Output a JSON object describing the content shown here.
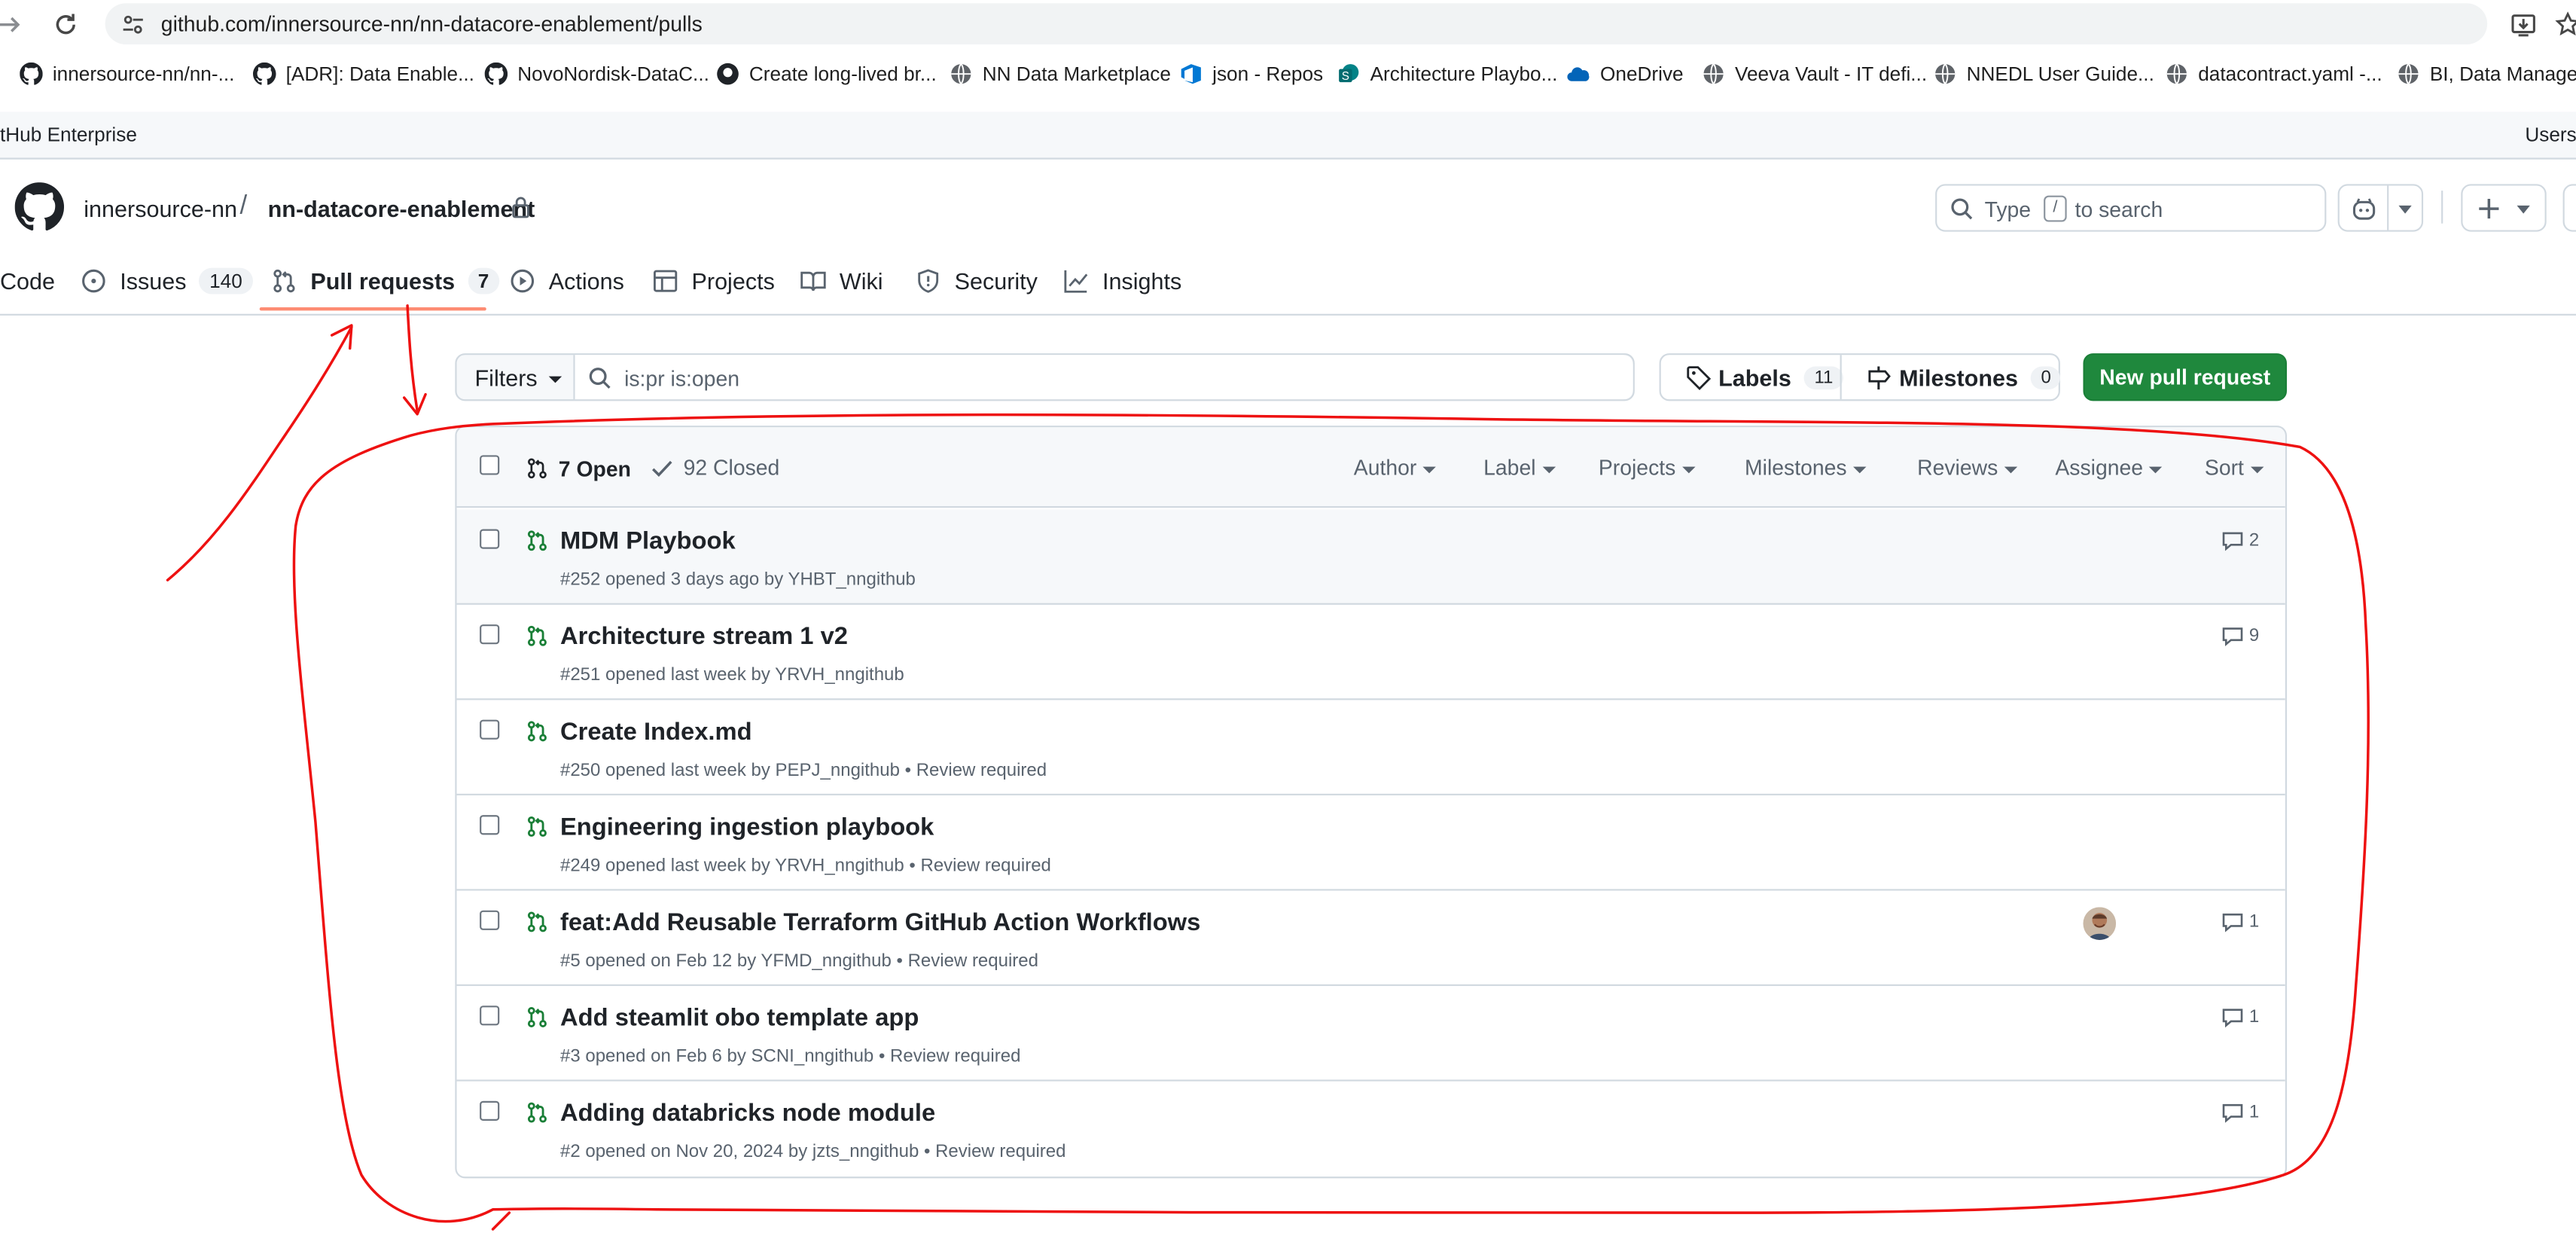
{
  "browser": {
    "url": "github.com/innersource-nn/nn-datacore-enablement/pulls",
    "bookmarks": [
      {
        "label": "innersource-nn/nn-...",
        "icon": "github-icon"
      },
      {
        "label": "[ADR]: Data Enable...",
        "icon": "github-icon"
      },
      {
        "label": "NovoNordisk-DataC...",
        "icon": "github-icon"
      },
      {
        "label": "Create long-lived br...",
        "icon": "github-icon"
      },
      {
        "label": "NN Data Marketplace",
        "icon": "globe-icon"
      },
      {
        "label": "json - Repos",
        "icon": "azure-devops-icon"
      },
      {
        "label": "Architecture Playbo...",
        "icon": "sharepoint-icon"
      },
      {
        "label": "OneDrive",
        "icon": "onedrive-icon"
      },
      {
        "label": "Veeva Vault - IT defi...",
        "icon": "globe-icon"
      },
      {
        "label": "NNEDL User Guide...",
        "icon": "globe-icon"
      },
      {
        "label": "datacontract.yaml -...",
        "icon": "globe-icon"
      },
      {
        "label": "BI, Data Managem",
        "icon": "globe-icon"
      }
    ]
  },
  "enterprise": {
    "title": "tHub Enterprise",
    "users_link": "Users"
  },
  "repo": {
    "owner": "innersource-nn",
    "separator": "/",
    "name": "nn-datacore-enablement"
  },
  "search": {
    "placeholder_prefix": "Type",
    "key": "/",
    "placeholder_suffix": "to search"
  },
  "tabs": [
    {
      "label": "Code",
      "icon": "code-icon"
    },
    {
      "label": "Issues",
      "icon": "issue-icon",
      "counter": "140"
    },
    {
      "label": "Pull requests",
      "icon": "pull-request-icon",
      "counter": "7",
      "selected": true
    },
    {
      "label": "Actions",
      "icon": "play-icon"
    },
    {
      "label": "Projects",
      "icon": "table-icon"
    },
    {
      "label": "Wiki",
      "icon": "book-icon"
    },
    {
      "label": "Security",
      "icon": "shield-icon"
    },
    {
      "label": "Insights",
      "icon": "graph-icon"
    }
  ],
  "subnav": {
    "filters_label": "Filters",
    "query": "is:pr is:open",
    "labels_label": "Labels",
    "labels_count": "11",
    "milestones_label": "Milestones",
    "milestones_count": "0",
    "new_pr_label": "New pull request"
  },
  "list": {
    "open_label": "7 Open",
    "closed_label": "92 Closed",
    "filters": [
      "Author",
      "Label",
      "Projects",
      "Milestones",
      "Reviews",
      "Assignee",
      "Sort"
    ],
    "items": [
      {
        "title": "MDM Playbook",
        "meta": "#252 opened 3 days ago by YHBT_nngithub",
        "comments": "2"
      },
      {
        "title": "Architecture stream 1 v2",
        "meta": "#251 opened last week by YRVH_nngithub",
        "comments": "9"
      },
      {
        "title": "Create Index.md",
        "meta": "#250 opened last week by PEPJ_nngithub • Review required"
      },
      {
        "title": "Engineering ingestion playbook",
        "meta": "#249 opened last week by YRVH_nngithub • Review required"
      },
      {
        "title": "feat:Add Reusable Terraform GitHub Action Workflows",
        "meta": "#5 opened on Feb 12 by YFMD_nngithub • Review required",
        "comments": "1",
        "has_avatar": true
      },
      {
        "title": "Add steamlit obo template app",
        "meta": "#3 opened on Feb 6 by SCNI_nngithub • Review required",
        "comments": "1"
      },
      {
        "title": "Adding databricks node module",
        "meta": "#2 opened on Nov 20, 2024 by jzts_nngithub • Review required",
        "comments": "1"
      }
    ]
  },
  "colors": {
    "accent_green": "#1f883d",
    "open_icon_green": "#1a7f37",
    "tab_underline": "#fd8c73",
    "annotation_red": "#ee1111"
  }
}
